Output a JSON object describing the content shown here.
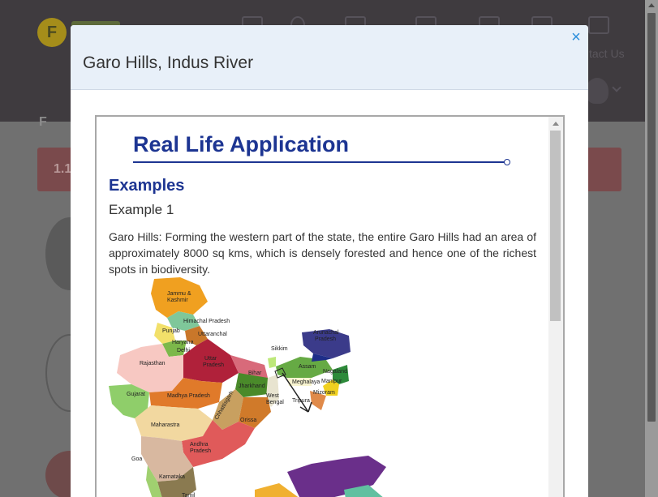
{
  "background": {
    "logo_letter": "F",
    "contact_label": "tact Us",
    "title_fragment": "F",
    "tab_fragment": "1.1"
  },
  "modal": {
    "title": "Garo Hills, Indus River",
    "close_icon": "×",
    "section_title": "Real Life Application",
    "examples_heading": "Examples",
    "example_label": "Example 1",
    "example_text": "Garo Hills: Forming the western part of the state, the entire Garo Hills had an area of approximately 8000 sq kms, which is densely forested and hence one of the richest spots in biodiversity."
  },
  "map": {
    "labels": [
      "Jammu & Kashmir",
      "Himachal Pradesh",
      "Punjab",
      "Uttaranchal",
      "Haryana",
      "Delhi",
      "Rajasthan",
      "Uttar Pradesh",
      "Sikkim",
      "Arunachal Pradesh",
      "Assam",
      "Nagaland",
      "Bihar",
      "Meghalaya",
      "Manipur",
      "Mizoram",
      "Tripura",
      "Gujarat",
      "Madhya Pradesh",
      "Jharkhand",
      "West Bengal",
      "Chhattisgarh",
      "Orissa",
      "Maharastra",
      "Andhra Pradesh",
      "Goa",
      "Karnataka",
      "Tamil"
    ]
  },
  "colors": {
    "accent": "#1d3592",
    "close": "#2d8fdc",
    "header_bg": "#e8f0f9"
  }
}
